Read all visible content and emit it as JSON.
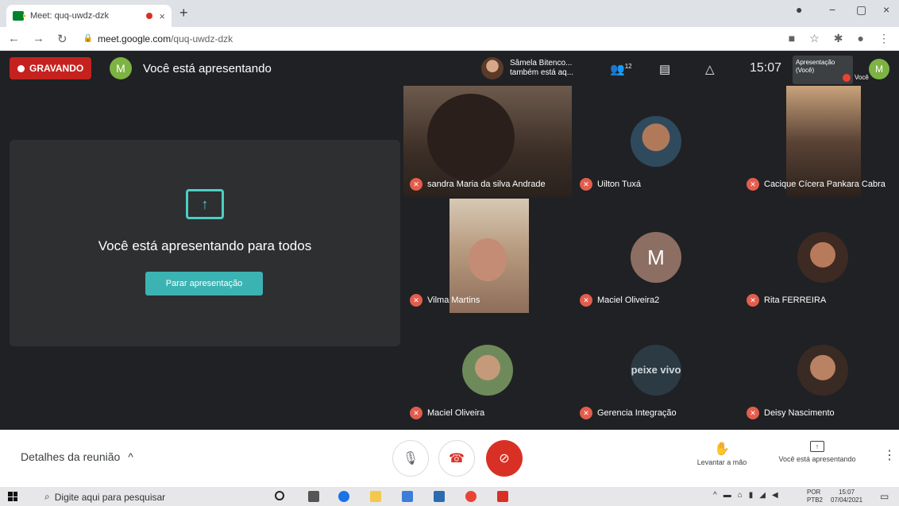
{
  "browser": {
    "tab_title": "Meet: quq-uwdz-dzk",
    "tab_close": "×",
    "new_tab": "+",
    "url_host": "meet.google.com",
    "url_path": "/quq-uwdz-dzk",
    "win_min": "−",
    "win_restore": "▢",
    "win_close": "×"
  },
  "header": {
    "recording_label": "GRAVANDO",
    "avatar_letter": "M",
    "presenting_title": "Você está apresentando",
    "notification_line1": "Sâmela Bitenco...",
    "notification_line2": "também está aq...",
    "participants_count": "12",
    "time": "15:07",
    "self_thumb_label": "Apresentação (Você)",
    "self_avatar": "M",
    "self_label": "Você"
  },
  "presenting_panel": {
    "message": "Você está apresentando para todos",
    "stop_button": "Parar apresentação"
  },
  "participants": [
    {
      "name": "sandra Maria da silva Andrade"
    },
    {
      "name": "Uilton Tuxá"
    },
    {
      "name": "Cacique Cícera Pankara Cabra"
    },
    {
      "name": "Vilma Martins"
    },
    {
      "name": "Maciel Oliveira2",
      "avatar": "M"
    },
    {
      "name": "Rita FERREIRA"
    },
    {
      "name": "Maciel Oliveira"
    },
    {
      "name": "Gerencia Integração",
      "logo_text": "peixe vivo"
    },
    {
      "name": "Deisy Nascimento"
    }
  ],
  "bottom": {
    "meeting_details": "Detalhes da reunião",
    "details_caret": "^",
    "raise_hand": "Levantar a mão",
    "presenting_button": "Você está apresentando",
    "more": "⋮"
  },
  "taskbar": {
    "search_placeholder": "Digite aqui para pesquisar",
    "lang_line1": "POR",
    "lang_line2": "PTB2",
    "clock_time": "15:07",
    "clock_date": "07/04/2021"
  },
  "colors": {
    "recording_red": "#c5221f",
    "accent_teal": "#3bb3b3",
    "hangup_red": "#d93025",
    "avatar_green": "#7cb342"
  }
}
